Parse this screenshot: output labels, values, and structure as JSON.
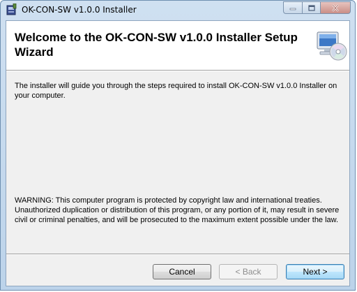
{
  "window": {
    "title": "OK-CON-SW v1.0.0 Installer"
  },
  "header": {
    "title": "Welcome to the OK-CON-SW v1.0.0 Installer Setup Wizard"
  },
  "body": {
    "intro": "The installer will guide you through the steps required to install OK-CON-SW v1.0.0 Installer on your computer.",
    "warning": "WARNING: This computer program is protected by copyright law and international treaties. Unauthorized duplication or distribution of this program, or any portion of it, may result in severe civil or criminal penalties, and will be prosecuted to the maximum extent possible under the law."
  },
  "buttons": {
    "cancel": "Cancel",
    "back": "< Back",
    "next": "Next >"
  },
  "icons": {
    "app": "installer-icon",
    "header": "computer-cd-icon",
    "minimize": "minimize-icon",
    "maximize": "maximize-icon",
    "close": "close-icon"
  }
}
